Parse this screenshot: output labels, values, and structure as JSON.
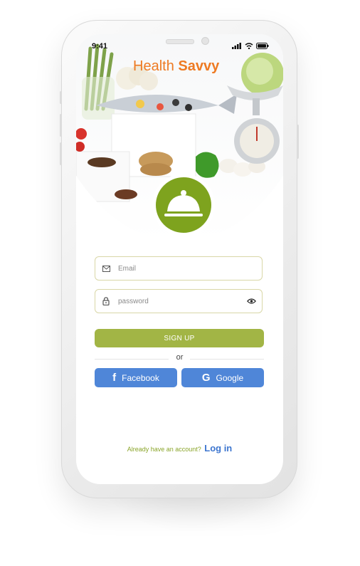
{
  "status_bar": {
    "time": "9:41"
  },
  "app": {
    "title_regular": "Health ",
    "title_bold": "Savvy"
  },
  "form": {
    "email_placeholder": "Email",
    "password_placeholder": "password",
    "signup_label": "SIGN UP",
    "or_label": "or",
    "facebook_label": "Facebook",
    "facebook_glyph": "f",
    "google_label": "Google",
    "google_glyph": "G"
  },
  "footer": {
    "question": "Already have an account?",
    "login_label": "Log in"
  },
  "colors": {
    "brand_orange": "#ee7a22",
    "brand_green": "#7ea31e",
    "signup_green": "#a2b545",
    "social_blue": "#4f86d8",
    "link_blue": "#3d76cf"
  },
  "icons": [
    "mail-icon",
    "lock-icon",
    "eye-icon",
    "cloche-icon",
    "signal-icon",
    "wifi-icon",
    "battery-icon"
  ]
}
